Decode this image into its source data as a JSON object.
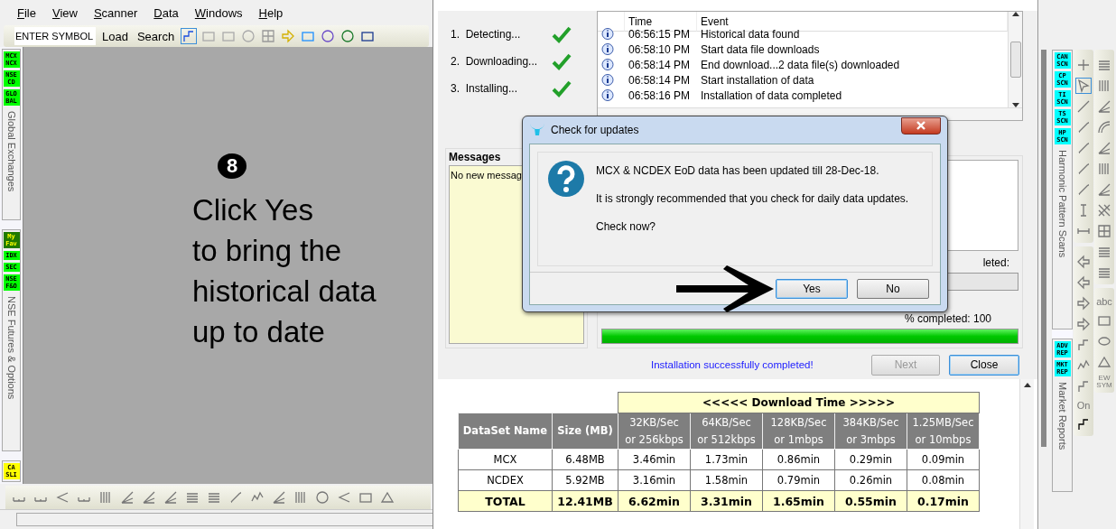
{
  "menu": [
    {
      "label": "File"
    },
    {
      "label": "View"
    },
    {
      "label": "Scanner"
    },
    {
      "label": "Data"
    },
    {
      "label": "Windows"
    },
    {
      "label": "Help"
    }
  ],
  "toolbar": {
    "symbol": "ENTER SYMBOL",
    "buttons": [
      "Load",
      "Search"
    ]
  },
  "left_tabs": [
    {
      "title": "Global Exchanges",
      "tags": [
        {
          "label": "MCX\nNCX",
          "color": "#00ff00"
        },
        {
          "label": "NSE\nCD",
          "color": "#00ff00"
        },
        {
          "label": "GLO\nBAL",
          "color": "#00ff00"
        }
      ]
    },
    {
      "title": "NSE Futures & Options",
      "tags": [
        {
          "label": "My\nFav",
          "color": "#1f7a00"
        },
        {
          "label": "IDX",
          "color": "#00ff00"
        },
        {
          "label": "SEC",
          "color": "#00ff00"
        },
        {
          "label": "NSE\nF&O",
          "color": "#00ff00"
        }
      ]
    },
    {
      "tags": [
        {
          "label": "CA\nSLI",
          "color": "#ffff00"
        }
      ]
    }
  ],
  "annotation": {
    "step": "8",
    "lines": [
      "Click Yes",
      "to bring the",
      "historical data",
      "up to date"
    ]
  },
  "installer": {
    "steps": [
      {
        "label": "1.  Detecting...",
        "done": true
      },
      {
        "label": "2.  Downloading...",
        "done": true
      },
      {
        "label": "3.  Installing...",
        "done": true
      }
    ],
    "log": {
      "columns": [
        "Time",
        "Event"
      ],
      "rows": [
        {
          "time": "06:56:15 PM",
          "event": "Historical data found"
        },
        {
          "time": "06:58:10 PM",
          "event": "Start data file downloads"
        },
        {
          "time": "06:58:14 PM",
          "event": "End download...2 data file(s) downloaded"
        },
        {
          "time": "06:58:14 PM",
          "event": "Start installation of data"
        },
        {
          "time": "06:58:16 PM",
          "event": "Installation of data completed"
        }
      ]
    },
    "messages": {
      "title": "Messages",
      "text": "No new messag"
    },
    "progress": [
      {
        "label": "leted:",
        "level": 0
      },
      {
        "label": "% completed: 100",
        "level": 1
      }
    ],
    "status": "Installation successfully completed!",
    "buttons": [
      {
        "label": "Next",
        "disabled": true,
        "focused": false
      },
      {
        "label": "Close",
        "disabled": false,
        "focused": true
      }
    ]
  },
  "dialog": {
    "title": "Check for updates",
    "lines": [
      "MCX & NCDEX EoD data has been updated till 28-Dec-18.",
      "It is strongly recommended that you check for daily data updates.",
      "Check now?"
    ],
    "buttons": [
      {
        "label": "Yes",
        "selected": true
      },
      {
        "label": "No",
        "selected": false
      }
    ]
  },
  "download_table": {
    "group_header": "<<<<< Download Time >>>>>",
    "columns": [
      "DataSet Name",
      "Size (MB)",
      "32KB/Sec\nor 256kbps",
      "64KB/Sec\nor 512kbps",
      "128KB/Sec\nor 1mbps",
      "384KB/Sec\nor 3mbps",
      "1.25MB/Sec\nor 10mbps"
    ],
    "rows": [
      {
        "kind": "data",
        "cells": [
          "MCX",
          "6.48MB",
          "3.46min",
          "1.73min",
          "0.86min",
          "0.29min",
          "0.09min"
        ]
      },
      {
        "kind": "data",
        "cells": [
          "NCDEX",
          "5.92MB",
          "3.16min",
          "1.58min",
          "0.79min",
          "0.26min",
          "0.08min"
        ]
      },
      {
        "kind": "total",
        "cells": [
          "TOTAL",
          "12.41MB",
          "6.62min",
          "3.31min",
          "1.65min",
          "0.55min",
          "0.17min"
        ]
      }
    ]
  },
  "right_tabs": [
    {
      "title": "Harmonic Pattern Scans",
      "tags": [
        {
          "label": "CAN\nSCN",
          "color": "#00ffff"
        },
        {
          "label": "CP\nSCN",
          "color": "#00ffff"
        },
        {
          "label": "TI\nSCN",
          "color": "#00ffff"
        },
        {
          "label": "TS\nSCN",
          "color": "#00ffff"
        },
        {
          "label": "HP\nSCN",
          "color": "#00ffff"
        }
      ]
    },
    {
      "title": "Market Reports",
      "tags": [
        {
          "label": "ADV\nREP",
          "color": "#00ffff"
        },
        {
          "label": "MKT\nREP",
          "color": "#00ffff"
        }
      ]
    }
  ],
  "tool_labels": {
    "on": "On",
    "text": "abc",
    "symbol": "EW\nSYM"
  }
}
